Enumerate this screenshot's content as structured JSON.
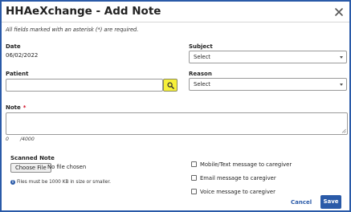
{
  "dialog": {
    "title": "HHAeXchange - Add Note",
    "required_notice": "All fields marked with an asterisk (*) are required."
  },
  "date": {
    "label": "Date",
    "value": "06/02/2022"
  },
  "subject": {
    "label": "Subject",
    "selected": "Select"
  },
  "patient": {
    "label": "Patient",
    "value": ""
  },
  "reason": {
    "label": "Reason",
    "selected": "Select"
  },
  "note": {
    "label": "Note",
    "required_mark": "*",
    "counter_current": "0",
    "counter_max": "/4000",
    "value": ""
  },
  "scanned_note": {
    "label": "Scanned Note",
    "choose_file_label": "Choose File",
    "file_status": "No file chosen",
    "size_hint": "Files must be 1000 KB in size or smaller."
  },
  "options": [
    {
      "label": "Mobile/Text message to caregiver",
      "checked": false
    },
    {
      "label": "Email message to caregiver",
      "checked": false
    },
    {
      "label": "Voice message to caregiver",
      "checked": false
    }
  ],
  "footer": {
    "cancel_label": "Cancel",
    "save_label": "Save"
  },
  "colors": {
    "accent": "#2a5aa8",
    "search_button": "#f6f03a",
    "required": "#d0021b"
  },
  "icons": {
    "close": "close-icon",
    "search": "search-icon",
    "info": "info-icon",
    "resize": "resize-handle-icon"
  }
}
